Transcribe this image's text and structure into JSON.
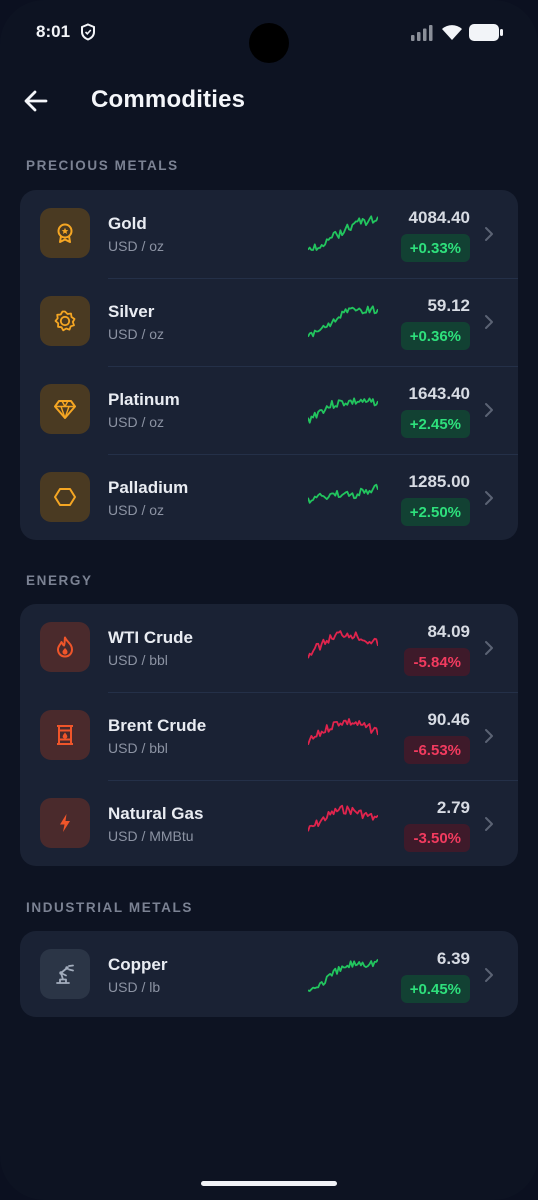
{
  "status_bar": {
    "time": "8:01"
  },
  "header": {
    "title": "Commodities"
  },
  "colors": {
    "up": "#2ee07c",
    "down": "#f23b5f",
    "up_line": "#22c55e",
    "down_line": "#e0244d"
  },
  "sections": [
    {
      "title": "PRECIOUS METALS",
      "items": [
        {
          "name": "Gold",
          "unit": "USD / oz",
          "price": "4084.40",
          "change": "+0.33%",
          "trend": "up",
          "icon": "medal-icon"
        },
        {
          "name": "Silver",
          "unit": "USD / oz",
          "price": "59.12",
          "change": "+0.36%",
          "trend": "up",
          "icon": "badge-icon"
        },
        {
          "name": "Platinum",
          "unit": "USD / oz",
          "price": "1643.40",
          "change": "+2.45%",
          "trend": "up",
          "icon": "diamond-icon"
        },
        {
          "name": "Palladium",
          "unit": "USD / oz",
          "price": "1285.00",
          "change": "+2.50%",
          "trend": "up",
          "icon": "hexagon-icon"
        }
      ]
    },
    {
      "title": "ENERGY",
      "items": [
        {
          "name": "WTI Crude",
          "unit": "USD / bbl",
          "price": "84.09",
          "change": "-5.84%",
          "trend": "down",
          "icon": "flame-icon"
        },
        {
          "name": "Brent Crude",
          "unit": "USD / bbl",
          "price": "90.46",
          "change": "-6.53%",
          "trend": "down",
          "icon": "oil-barrel-icon"
        },
        {
          "name": "Natural Gas",
          "unit": "USD / MMBtu",
          "price": "2.79",
          "change": "-3.50%",
          "trend": "down",
          "icon": "lightning-icon"
        }
      ]
    },
    {
      "title": "INDUSTRIAL METALS",
      "items": [
        {
          "name": "Copper",
          "unit": "USD / lb",
          "price": "6.39",
          "change": "+0.45%",
          "trend": "up",
          "icon": "robot-arm-icon"
        }
      ]
    }
  ]
}
